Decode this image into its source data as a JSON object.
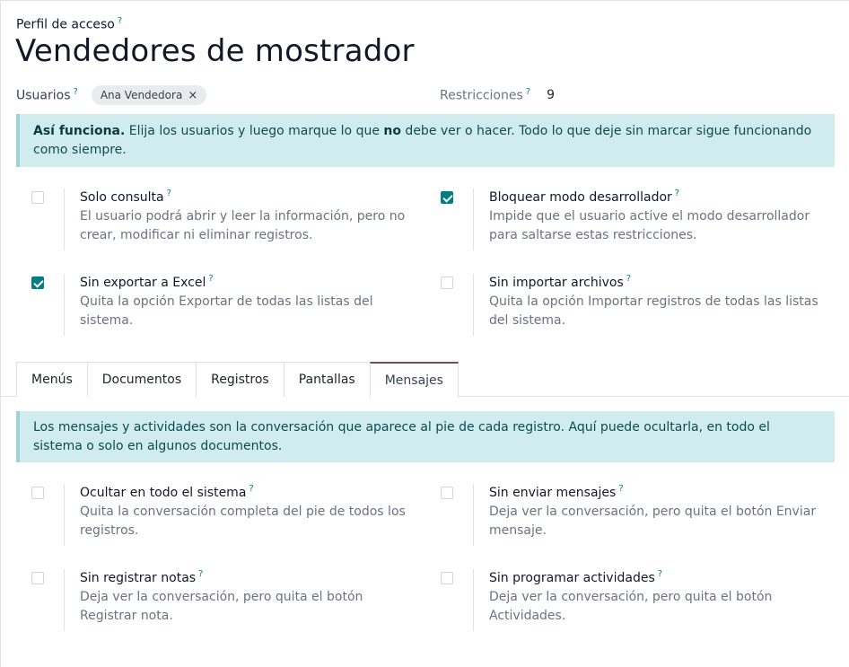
{
  "profile": {
    "label": "Perfil de acceso",
    "help": "?",
    "name": "Vendedores de mostrador"
  },
  "users": {
    "label": "Usuarios",
    "help": "?",
    "tags": [
      {
        "name": "Ana Vendedora",
        "remove": "×"
      }
    ]
  },
  "restrictions": {
    "label": "Restricciones",
    "help": "?",
    "value": "9"
  },
  "info": {
    "strong": "Así funciona.",
    "part1": " Elija los usuarios y luego marque lo que ",
    "no": "no",
    "part2": " debe ver o hacer. Todo lo que deje sin marcar sigue funcionando como siempre."
  },
  "options": [
    {
      "title": "Solo consulta",
      "help": "?",
      "desc": "El usuario podrá abrir y leer la información, pero no crear, modificar ni eliminar registros.",
      "checked": false
    },
    {
      "title": "Bloquear modo desarrollador",
      "help": "?",
      "desc": "Impide que el usuario active el modo desarrollador para saltarse estas restricciones.",
      "checked": true
    },
    {
      "title": "Sin exportar a Excel",
      "help": "?",
      "desc": "Quita la opción Exportar de todas las listas del sistema.",
      "checked": true
    },
    {
      "title": "Sin importar archivos",
      "help": "?",
      "desc": "Quita la opción Importar registros de todas las listas del sistema.",
      "checked": false
    }
  ],
  "tabs": [
    {
      "label": "Menús",
      "active": false
    },
    {
      "label": "Documentos",
      "active": false
    },
    {
      "label": "Registros",
      "active": false
    },
    {
      "label": "Pantallas",
      "active": false
    },
    {
      "label": "Mensajes",
      "active": true
    }
  ],
  "messages_info": "Los mensajes y actividades son la conversación que aparece al pie de cada registro. Aquí puede ocultarla, en todo el sistema o solo en algunos documentos.",
  "message_options": [
    {
      "title": "Ocultar en todo el sistema",
      "help": "?",
      "desc": "Quita la conversación completa del pie de todos los registros.",
      "checked": false
    },
    {
      "title": "Sin enviar mensajes",
      "help": "?",
      "desc": "Deja ver la conversación, pero quita el botón Enviar mensaje.",
      "checked": false
    },
    {
      "title": "Sin registrar notas",
      "help": "?",
      "desc": "Deja ver la conversación, pero quita el botón Registrar nota.",
      "checked": false
    },
    {
      "title": "Sin programar actividades",
      "help": "?",
      "desc": "Deja ver la conversación, pero quita el botón Actividades.",
      "checked": false
    }
  ],
  "colors": {
    "accent": "#017e84",
    "tab_active": "#714b67",
    "alert_bg": "#d1ecef"
  }
}
